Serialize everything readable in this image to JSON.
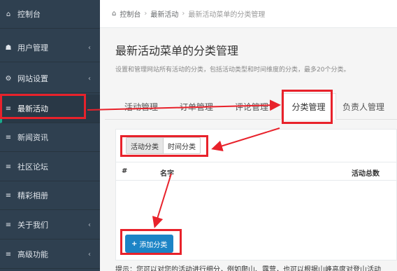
{
  "sidebar": {
    "items": [
      {
        "label": "控制台",
        "icon": "dashboard-icon",
        "glyph": "⌂",
        "chevron": ""
      },
      {
        "label": "用户管理",
        "icon": "users-icon",
        "glyph": "☗",
        "chevron": "‹"
      },
      {
        "label": "网站设置",
        "icon": "gears-icon",
        "glyph": "⚙",
        "chevron": "‹"
      },
      {
        "label": "最新活动",
        "icon": "list-icon",
        "glyph": "≡",
        "chevron": ""
      },
      {
        "label": "新闻资讯",
        "icon": "list-icon",
        "glyph": "≡",
        "chevron": ""
      },
      {
        "label": "社区论坛",
        "icon": "list-icon",
        "glyph": "≡",
        "chevron": ""
      },
      {
        "label": "精彩相册",
        "icon": "list-icon",
        "glyph": "≡",
        "chevron": ""
      },
      {
        "label": "关于我们",
        "icon": "list-icon",
        "glyph": "≡",
        "chevron": "‹"
      },
      {
        "label": "高级功能",
        "icon": "list-icon",
        "glyph": "≡",
        "chevron": "‹"
      }
    ]
  },
  "breadcrumb": {
    "home_glyph": "⌂",
    "items": [
      "控制台",
      "最新活动",
      "最新活动菜单的分类管理"
    ],
    "separator": "›"
  },
  "page": {
    "title": "最新活动菜单的分类管理",
    "description": "设置和管理网站所有活动的分类，包括活动类型和时间维度的分类，最多20个分类。"
  },
  "tabs": [
    "活动管理",
    "订单管理",
    "评论管理",
    "分类管理",
    "负责人管理"
  ],
  "segmented": [
    "活动分类",
    "时间分类"
  ],
  "table": {
    "columns": [
      "#",
      "名字",
      "活动总数"
    ]
  },
  "add_button": {
    "glyph": "+",
    "label": "添加分类"
  },
  "tip": "提示：您可以对您的活动进行细分，例如爬山、露营，也可以根据山峰高度对登山活动",
  "colors": {
    "sidebar_bg": "#2f4050",
    "accent": "#1c84c6",
    "annotation_red": "#e8222b"
  }
}
